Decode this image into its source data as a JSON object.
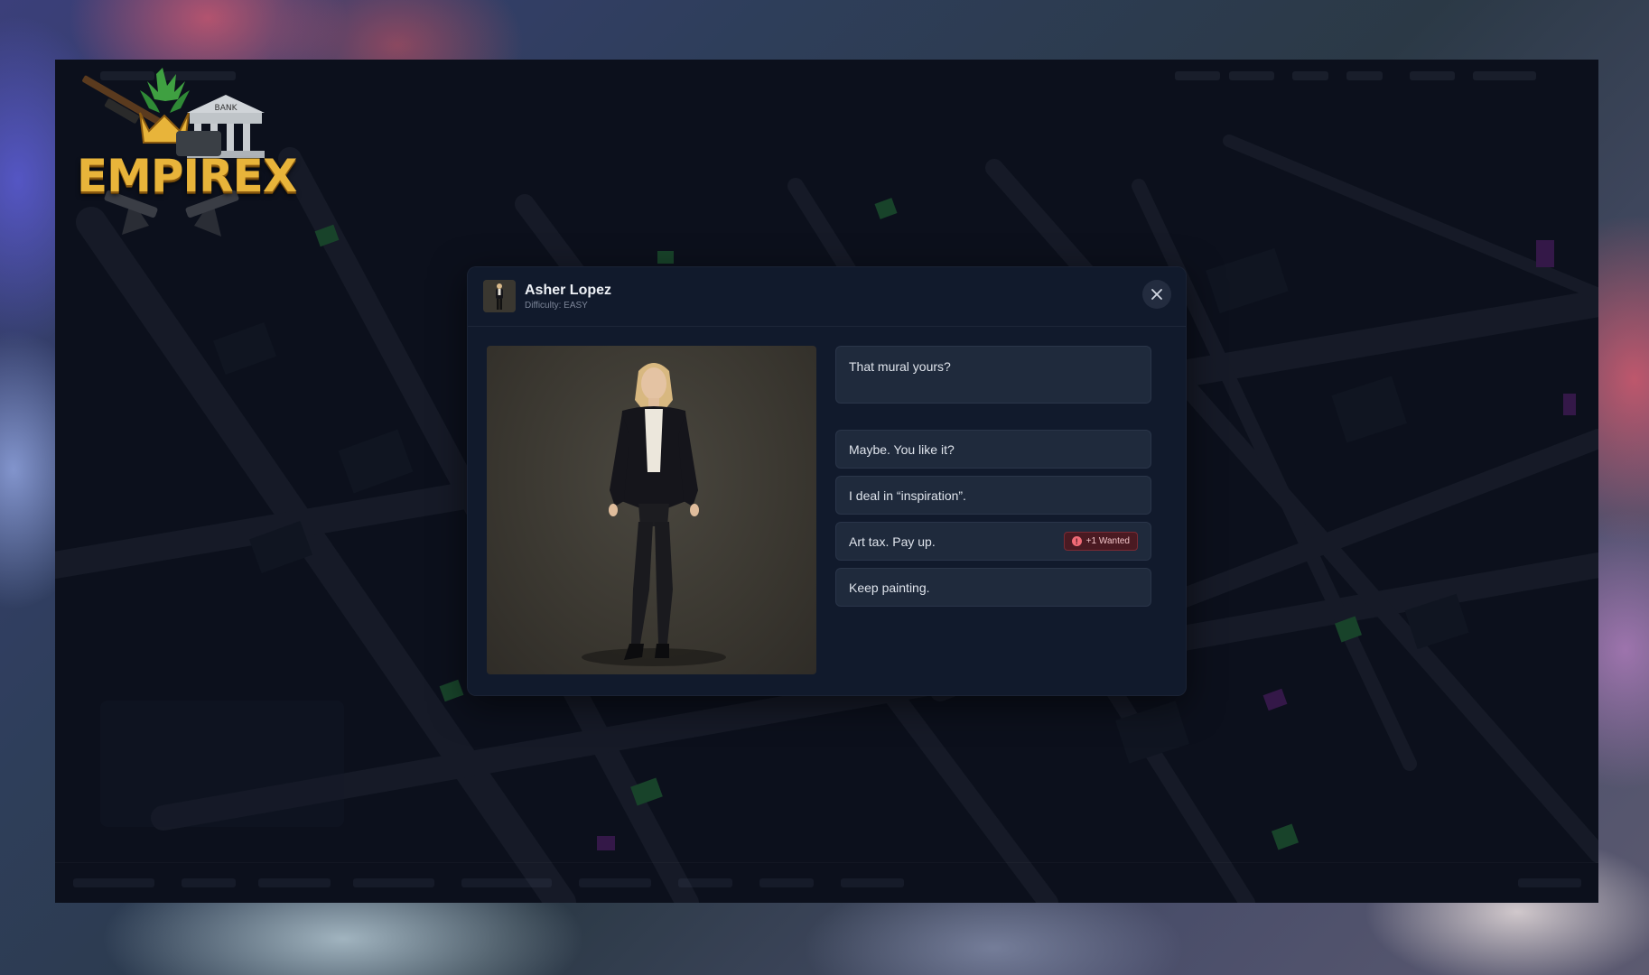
{
  "logo": {
    "text": "EMPIREX",
    "bank_sign": "BANK"
  },
  "dialog": {
    "character_name": "Asher Lopez",
    "difficulty": "Difficulty: EASY",
    "npc_line": "That mural yours?",
    "options": [
      {
        "label": "Maybe. You like it?"
      },
      {
        "label": "I deal in “inspiration”."
      },
      {
        "label": "Art tax. Pay up.",
        "badge": "+1 Wanted",
        "badge_icon": "!"
      },
      {
        "label": "Keep painting."
      }
    ]
  },
  "colors": {
    "dialog_bg": "#111a2c",
    "option_bg": "#1f2a3c",
    "badge_bg": "#4a1a22",
    "badge_accent": "#f06a76",
    "logo_gold": "#e8b43a"
  }
}
